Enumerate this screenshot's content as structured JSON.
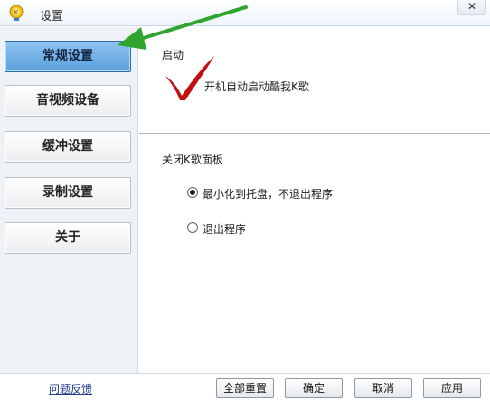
{
  "window": {
    "title": "设置",
    "icon": "kuge-app-icon",
    "close_label": "✕"
  },
  "sidebar": {
    "items": [
      {
        "label": "常规设置",
        "active": true
      },
      {
        "label": "音视频设备",
        "active": false
      },
      {
        "label": "缓冲设置",
        "active": false
      },
      {
        "label": "录制设置",
        "active": false
      },
      {
        "label": "关于",
        "active": false
      }
    ]
  },
  "main": {
    "startup": {
      "heading": "启动",
      "checkbox_label": "开机自动启动酷我K歌"
    },
    "close_panel": {
      "heading": "关闭K歌面板",
      "options": [
        {
          "label": "最小化到托盘，不退出程序",
          "selected": true
        },
        {
          "label": "退出程序",
          "selected": false
        }
      ]
    }
  },
  "footer": {
    "feedback_label": "问题反馈",
    "reset_label": "全部重置",
    "ok_label": "确定",
    "cancel_label": "取消",
    "apply_label": "应用"
  },
  "annotations": {
    "arrow_color": "#2ea62e",
    "check_color": "#c21010"
  }
}
